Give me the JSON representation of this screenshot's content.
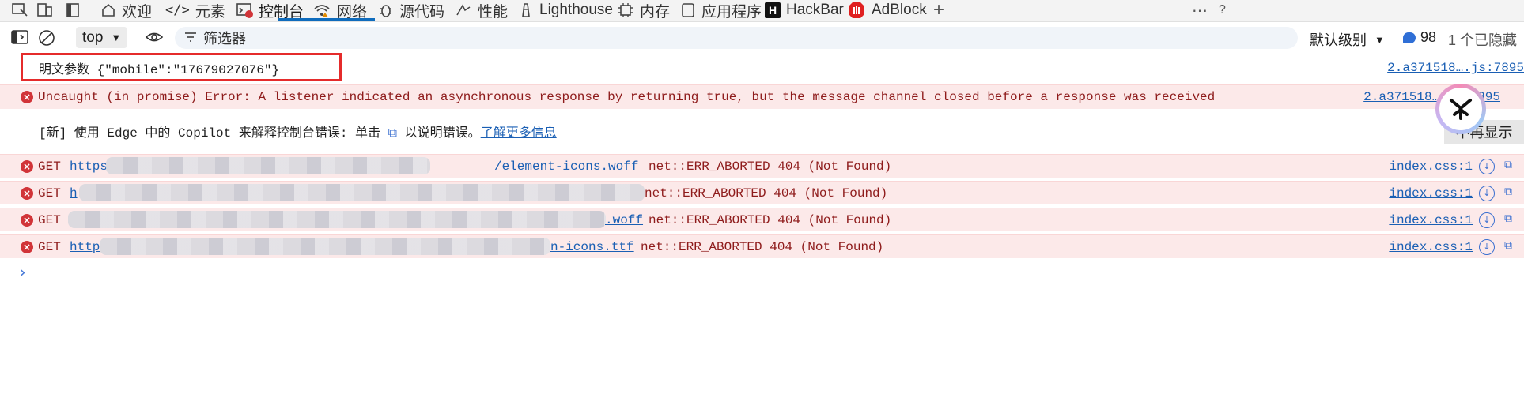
{
  "tabs": [
    {
      "label": "欢迎",
      "icon": "home-icon"
    },
    {
      "label": "元素",
      "icon": "code-icon"
    },
    {
      "label": "控制台",
      "icon": "console-icon"
    },
    {
      "label": "网络",
      "icon": "wifi-icon"
    },
    {
      "label": "源代码",
      "icon": "bug-icon"
    },
    {
      "label": "性能",
      "icon": "performance-icon"
    },
    {
      "label": "Lighthouse",
      "icon": "lighthouse-icon"
    },
    {
      "label": "内存",
      "icon": "memory-chip-icon"
    },
    {
      "label": "应用程序",
      "icon": "application-icon"
    },
    {
      "label": "HackBar",
      "icon": "hackbar-icon"
    },
    {
      "label": "AdBlock",
      "icon": "adblock-hand-icon"
    }
  ],
  "toolbar": {
    "context": "top",
    "filter_label": "筛选器",
    "level_label": "默认级别",
    "message_count": "98",
    "hidden_label": "1 个已隐藏"
  },
  "logs": [
    {
      "prefix": "明文参数 ",
      "text": "{\"mobile\":\"17679027076\"}",
      "source": "2.a371518….js:7895"
    },
    {
      "text": "Uncaught (in promise) Error: A listener indicated an asynchronous response by returning true, but the message channel closed before a response was received",
      "source": "2.a371518….js:7895"
    },
    {
      "pre": "[新] 使用 Edge 中的 Copilot 来解释控制台错误: 单击 ",
      "post": " 以说明错误。",
      "link": "了解更多信息"
    },
    {
      "method": "GET",
      "url_visible": "https",
      "url_tail": "/element-icons.woff",
      "status": "net::ERR_ABORTED 404 (Not Found)",
      "source": "index.css:1"
    },
    {
      "method": "GET",
      "url_visible": "h",
      "url_tail": "",
      "status": "net::ERR_ABORTED 404 (Not Found)",
      "source": "index.css:1"
    },
    {
      "method": "GET",
      "url_visible": "",
      "url_tail": ".woff",
      "status": "net::ERR_ABORTED 404 (Not Found)",
      "source": "index.css:1"
    },
    {
      "method": "GET",
      "url_visible": "http",
      "url_tail": "n-icons.ttf",
      "status": "net::ERR_ABORTED 404 (Not Found)",
      "source": "index.css:1"
    }
  ],
  "show_button": "不再显示",
  "colors": {
    "accent": "#0f6cbd",
    "error_bg": "#fce9e9",
    "error_text": "#8e1b1b",
    "link": "#1a5fb4",
    "highlight": "#e52b2b"
  }
}
